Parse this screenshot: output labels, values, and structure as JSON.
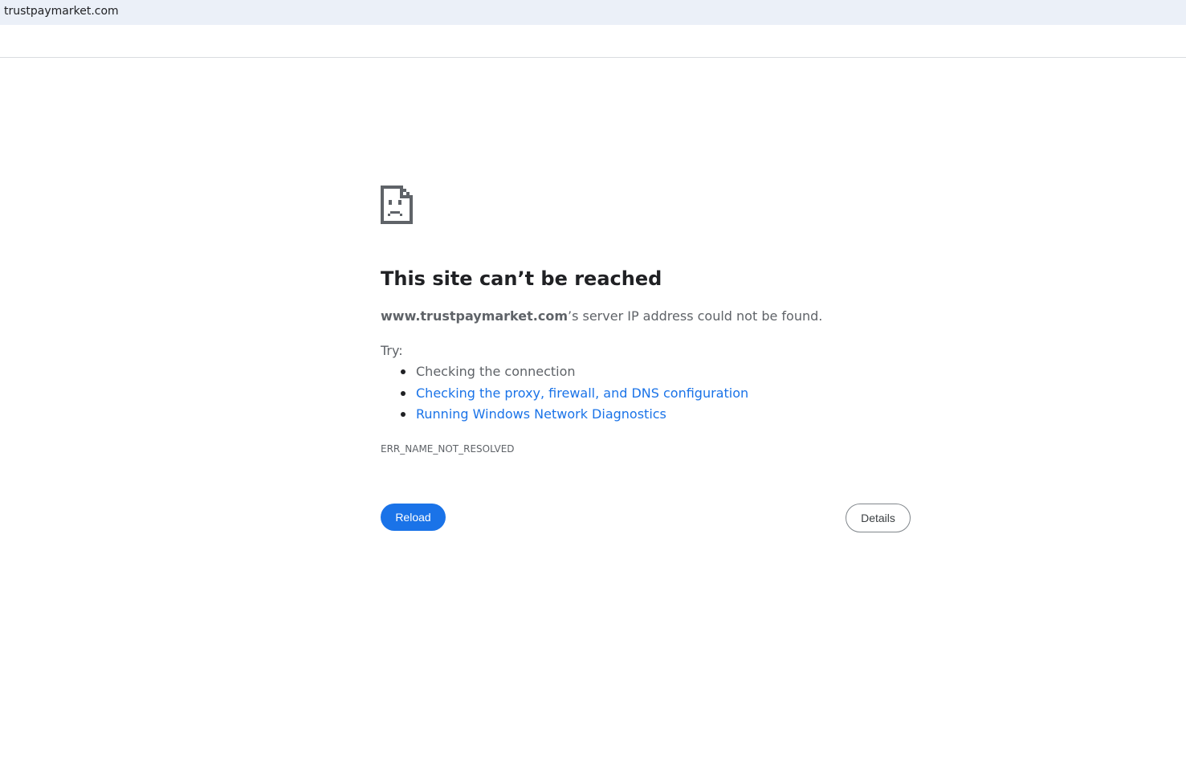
{
  "browser": {
    "url": "trustpaymarket.com"
  },
  "error_page": {
    "icon": "sad-page-icon",
    "headline": "This site can’t be reached",
    "host": "www.trustpaymarket.com",
    "description_suffix": "’s server IP address could not be found.",
    "try_label": "Try:",
    "suggestions": [
      {
        "text": "Checking the connection",
        "is_link": false
      },
      {
        "text": "Checking the proxy, firewall, and DNS configuration",
        "is_link": true
      },
      {
        "text": "Running Windows Network Diagnostics",
        "is_link": true
      }
    ],
    "error_code": "ERR_NAME_NOT_RESOLVED",
    "reload_label": "Reload",
    "details_label": "Details"
  },
  "colors": {
    "accent": "#1a73e8",
    "text_primary": "#202124",
    "text_secondary": "#5f6368",
    "url_bar_bg": "#ebf0f8"
  }
}
